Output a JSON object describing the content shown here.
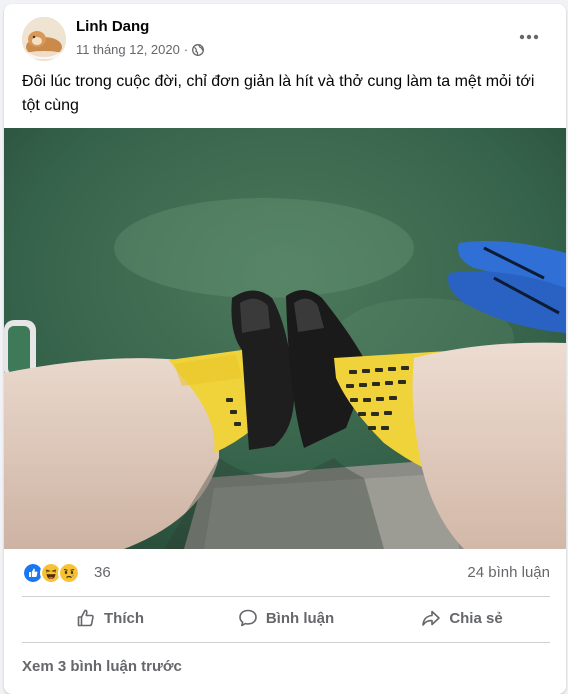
{
  "post": {
    "author": "Linh Dang",
    "date": "11 tháng 12, 2020",
    "separator": "·",
    "privacy_icon": "globe-icon",
    "caption": "Đôi lúc trong cuộc đời, chỉ đơn giản là hít và thở cung làm ta mệt mỏi tới tột cùng",
    "more_icon": "more-options-icon"
  },
  "reactions": {
    "icons": [
      "like-icon",
      "haha-icon",
      "sad-icon"
    ],
    "count": "36",
    "comments": "24 bình luận"
  },
  "actions": {
    "like_label": "Thích",
    "comment_label": "Bình luận",
    "share_label": "Chia sẻ"
  },
  "comments": {
    "view_previous": "Xem 3 bình luận trước"
  },
  "colors": {
    "accent": "#1877f2",
    "secondary_text": "#65676b",
    "divider": "#ced0d4"
  }
}
